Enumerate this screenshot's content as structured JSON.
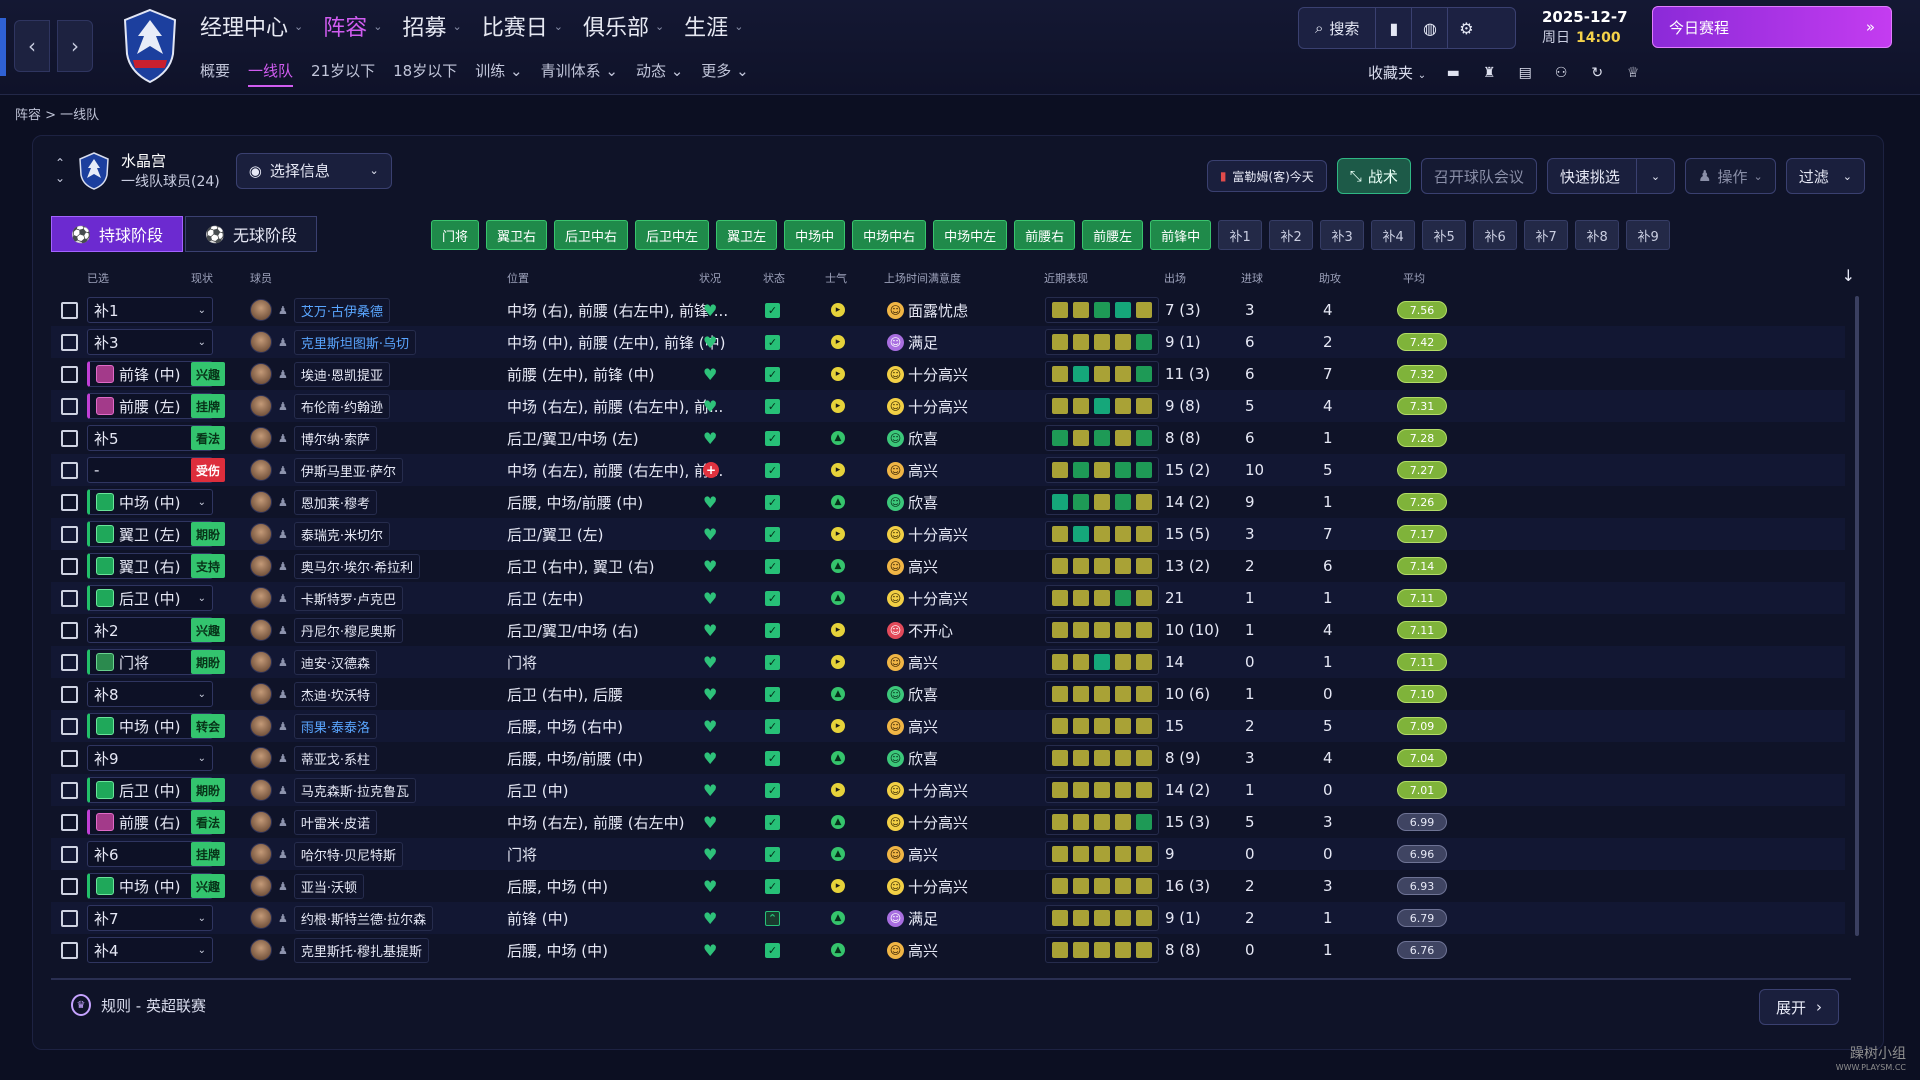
{
  "nav": {
    "main": [
      "经理中心",
      "阵容",
      "招募",
      "比赛日",
      "俱乐部",
      "生涯"
    ],
    "active_main": 1,
    "sub": [
      "概要",
      "一线队",
      "21岁以下",
      "18岁以下",
      "训练",
      "青训体系",
      "动态",
      "更多"
    ],
    "active_sub": 1
  },
  "toolbar": {
    "search_label": "搜索",
    "date": "2025-12-7",
    "weekday": "周日",
    "time": "14:00",
    "continue_label": "今日赛程",
    "favorites_label": "收藏夹"
  },
  "breadcrumb": "阵容 > 一线队",
  "team": {
    "name": "水晶宫",
    "subtitle": "一线队球员(24)"
  },
  "header": {
    "select_info_label": "选择信息",
    "next_match": "富勒姆(客)今天",
    "tactics_label": "战术",
    "team_meeting_label": "召开球队会议",
    "quick_pick_label": "快速挑选",
    "actions_label": "操作",
    "filter_label": "过滤"
  },
  "phase_tabs": [
    "持球阶段",
    "无球阶段"
  ],
  "position_chips": [
    "门将",
    "翼卫右",
    "后卫中右",
    "后卫中左",
    "翼卫左",
    "中场中",
    "中场中右",
    "中场中左",
    "前腰右",
    "前腰左",
    "前锋中"
  ],
  "sub_chips": [
    "补1",
    "补2",
    "补3",
    "补4",
    "补5",
    "补6",
    "补7",
    "补8",
    "补9"
  ],
  "columns": {
    "selected": "已选",
    "status_now": "现状",
    "player": "球员",
    "position": "位置",
    "fitness": "状况",
    "condition": "状态",
    "morale": "士气",
    "playing_time": "上场时间满意度",
    "form": "近期表现",
    "apps": "出场",
    "goals": "进球",
    "assists": "助攻",
    "avg": "平均"
  },
  "players": [
    {
      "sel": "补1",
      "sel_type": "none",
      "tag": "",
      "tag_color": "",
      "name": "艾万·古伊桑德",
      "link": true,
      "pos": "中场 (右), 前腰 (右左中), 前锋 ...",
      "inj": false,
      "rest": false,
      "morale": "yellow",
      "mood": "面露忧虑",
      "mood_color": "orange",
      "form": [
        "gold",
        "gold",
        "green",
        "teal",
        "gold"
      ],
      "apps": "7 (3)",
      "goals": "3",
      "assists": "4",
      "avg": "7.56",
      "avg_class": "good"
    },
    {
      "sel": "补3",
      "sel_type": "none",
      "tag": "",
      "tag_color": "",
      "name": "克里斯坦图斯·乌切",
      "link": true,
      "pos": "中场 (中), 前腰 (左中), 前锋 (中)",
      "inj": false,
      "rest": false,
      "morale": "yellow",
      "mood": "满足",
      "mood_color": "purple",
      "form": [
        "gold",
        "gold",
        "gold",
        "gold",
        "green"
      ],
      "apps": "9 (1)",
      "goals": "6",
      "assists": "2",
      "avg": "7.42",
      "avg_class": "good"
    },
    {
      "sel": "前锋 (中)",
      "sel_type": "purple",
      "tag": "兴趣",
      "tag_color": "green",
      "name": "埃迪·恩凯提亚",
      "link": false,
      "pos": "前腰 (左中), 前锋 (中)",
      "inj": false,
      "rest": false,
      "morale": "yellow",
      "mood": "十分高兴",
      "mood_color": "yellow",
      "form": [
        "gold",
        "teal",
        "gold",
        "gold",
        "green"
      ],
      "apps": "11 (3)",
      "goals": "6",
      "assists": "7",
      "avg": "7.32",
      "avg_class": "good"
    },
    {
      "sel": "前腰 (左)",
      "sel_type": "purple",
      "tag": "挂牌",
      "tag_color": "green",
      "name": "布伦南·约翰逊",
      "link": false,
      "pos": "中场 (右左), 前腰 (右左中), 前...",
      "inj": false,
      "rest": false,
      "morale": "yellow",
      "mood": "十分高兴",
      "mood_color": "yellow",
      "form": [
        "gold",
        "gold",
        "teal",
        "gold",
        "gold"
      ],
      "apps": "9 (8)",
      "goals": "5",
      "assists": "4",
      "avg": "7.31",
      "avg_class": "good"
    },
    {
      "sel": "补5",
      "sel_type": "none",
      "tag": "看法",
      "tag_color": "green",
      "name": "博尔纳·索萨",
      "link": false,
      "pos": "后卫/翼卫/中场 (左)",
      "inj": false,
      "rest": false,
      "morale": "green",
      "mood": "欣喜",
      "mood_color": "green",
      "form": [
        "green",
        "gold",
        "green",
        "gold",
        "green"
      ],
      "apps": "8 (8)",
      "goals": "6",
      "assists": "1",
      "avg": "7.28",
      "avg_class": "good"
    },
    {
      "sel": "-",
      "sel_type": "none",
      "tag": "受伤",
      "tag_color": "red",
      "name": "伊斯马里亚·萨尔",
      "link": false,
      "pos": "中场 (右左), 前腰 (右左中), 前...",
      "inj": true,
      "rest": false,
      "morale": "yellow",
      "mood": "高兴",
      "mood_color": "orange",
      "form": [
        "gold",
        "green",
        "gold",
        "green",
        "green"
      ],
      "apps": "15 (2)",
      "goals": "10",
      "assists": "5",
      "avg": "7.27",
      "avg_class": "good"
    },
    {
      "sel": "中场 (中)",
      "sel_type": "green",
      "tag": "",
      "tag_color": "",
      "name": "恩加莱·穆考",
      "link": false,
      "pos": "后腰, 中场/前腰 (中)",
      "inj": false,
      "rest": false,
      "morale": "green",
      "mood": "欣喜",
      "mood_color": "green",
      "form": [
        "teal",
        "green",
        "gold",
        "green",
        "gold"
      ],
      "apps": "14 (2)",
      "goals": "9",
      "assists": "1",
      "avg": "7.26",
      "avg_class": "good"
    },
    {
      "sel": "翼卫 (左)",
      "sel_type": "green",
      "tag": "期盼",
      "tag_color": "green",
      "name": "泰瑞克·米切尔",
      "link": false,
      "pos": "后卫/翼卫 (左)",
      "inj": false,
      "rest": false,
      "morale": "yellow",
      "mood": "十分高兴",
      "mood_color": "yellow",
      "form": [
        "gold",
        "teal",
        "gold",
        "gold",
        "gold"
      ],
      "apps": "15 (5)",
      "goals": "3",
      "assists": "7",
      "avg": "7.17",
      "avg_class": "good"
    },
    {
      "sel": "翼卫 (右)",
      "sel_type": "green",
      "tag": "支持",
      "tag_color": "green",
      "name": "奥马尔·埃尔·希拉利",
      "link": false,
      "pos": "后卫 (右中), 翼卫 (右)",
      "inj": false,
      "rest": false,
      "morale": "green",
      "mood": "高兴",
      "mood_color": "orange",
      "form": [
        "gold",
        "gold",
        "gold",
        "gold",
        "gold"
      ],
      "apps": "13 (2)",
      "goals": "2",
      "assists": "6",
      "avg": "7.14",
      "avg_class": "good"
    },
    {
      "sel": "后卫 (中)",
      "sel_type": "green",
      "tag": "",
      "tag_color": "",
      "name": "卡斯特罗·卢克巴",
      "link": false,
      "pos": "后卫 (左中)",
      "inj": false,
      "rest": false,
      "morale": "green",
      "mood": "十分高兴",
      "mood_color": "yellow",
      "form": [
        "gold",
        "gold",
        "gold",
        "green",
        "gold"
      ],
      "apps": "21",
      "goals": "1",
      "assists": "1",
      "avg": "7.11",
      "avg_class": "good"
    },
    {
      "sel": "补2",
      "sel_type": "none",
      "tag": "兴趣",
      "tag_color": "green",
      "name": "丹尼尔·穆尼奥斯",
      "link": false,
      "pos": "后卫/翼卫/中场 (右)",
      "inj": false,
      "rest": false,
      "morale": "yellow",
      "mood": "不开心",
      "mood_color": "red",
      "form": [
        "gold",
        "gold",
        "gold",
        "gold",
        "gold"
      ],
      "apps": "10 (10)",
      "goals": "1",
      "assists": "4",
      "avg": "7.11",
      "avg_class": "good"
    },
    {
      "sel": "门将",
      "sel_type": "gk",
      "tag": "期盼",
      "tag_color": "green",
      "name": "迪安·汉德森",
      "link": false,
      "pos": "门将",
      "inj": false,
      "rest": false,
      "morale": "yellow",
      "mood": "高兴",
      "mood_color": "orange",
      "form": [
        "gold",
        "gold",
        "teal",
        "gold",
        "gold"
      ],
      "apps": "14",
      "goals": "0",
      "assists": "1",
      "avg": "7.11",
      "avg_class": "good"
    },
    {
      "sel": "补8",
      "sel_type": "none",
      "tag": "",
      "tag_color": "",
      "name": "杰迪·坎沃特",
      "link": false,
      "pos": "后卫 (右中), 后腰",
      "inj": false,
      "rest": false,
      "morale": "green",
      "mood": "欣喜",
      "mood_color": "green",
      "form": [
        "gold",
        "gold",
        "gold",
        "gold",
        "gold"
      ],
      "apps": "10 (6)",
      "goals": "1",
      "assists": "0",
      "avg": "7.10",
      "avg_class": "good"
    },
    {
      "sel": "中场 (中)",
      "sel_type": "green",
      "tag": "转会",
      "tag_color": "green",
      "name": "雨果·泰泰洛",
      "link": true,
      "pos": "后腰, 中场 (右中)",
      "inj": false,
      "rest": false,
      "morale": "yellow",
      "mood": "高兴",
      "mood_color": "orange",
      "form": [
        "gold",
        "gold",
        "gold",
        "gold",
        "gold"
      ],
      "apps": "15",
      "goals": "2",
      "assists": "5",
      "avg": "7.09",
      "avg_class": "good"
    },
    {
      "sel": "补9",
      "sel_type": "none",
      "tag": "",
      "tag_color": "",
      "name": "蒂亚戈·系柱",
      "link": false,
      "pos": "后腰, 中场/前腰 (中)",
      "inj": false,
      "rest": false,
      "morale": "green",
      "mood": "欣喜",
      "mood_color": "green",
      "form": [
        "gold",
        "gold",
        "gold",
        "gold",
        "gold"
      ],
      "apps": "8 (9)",
      "goals": "3",
      "assists": "4",
      "avg": "7.04",
      "avg_class": "good"
    },
    {
      "sel": "后卫 (中)",
      "sel_type": "green",
      "tag": "期盼",
      "tag_color": "green",
      "name": "马克森斯·拉克鲁瓦",
      "link": false,
      "pos": "后卫 (中)",
      "inj": false,
      "rest": false,
      "morale": "yellow",
      "mood": "十分高兴",
      "mood_color": "yellow",
      "form": [
        "gold",
        "gold",
        "gold",
        "gold",
        "gold"
      ],
      "apps": "14 (2)",
      "goals": "1",
      "assists": "0",
      "avg": "7.01",
      "avg_class": "good"
    },
    {
      "sel": "前腰 (右)",
      "sel_type": "purple",
      "tag": "看法",
      "tag_color": "green",
      "name": "叶雷米·皮诺",
      "link": false,
      "pos": "中场 (右左), 前腰 (右左中)",
      "inj": false,
      "rest": false,
      "morale": "green",
      "mood": "十分高兴",
      "mood_color": "yellow",
      "form": [
        "gold",
        "gold",
        "gold",
        "gold",
        "green"
      ],
      "apps": "15 (3)",
      "goals": "5",
      "assists": "3",
      "avg": "6.99",
      "avg_class": "ok"
    },
    {
      "sel": "补6",
      "sel_type": "none",
      "tag": "挂牌",
      "tag_color": "green",
      "name": "哈尔特·贝尼特斯",
      "link": false,
      "pos": "门将",
      "inj": false,
      "rest": false,
      "morale": "green",
      "mood": "高兴",
      "mood_color": "orange",
      "form": [
        "gold",
        "gold",
        "gold",
        "gold",
        "gold"
      ],
      "apps": "9",
      "goals": "0",
      "assists": "0",
      "avg": "6.96",
      "avg_class": "ok"
    },
    {
      "sel": "中场 (中)",
      "sel_type": "green",
      "tag": "兴趣",
      "tag_color": "green",
      "name": "亚当·沃顿",
      "link": false,
      "pos": "后腰, 中场 (中)",
      "inj": false,
      "rest": false,
      "morale": "yellow",
      "mood": "十分高兴",
      "mood_color": "yellow",
      "form": [
        "gold",
        "gold",
        "gold",
        "gold",
        "gold"
      ],
      "apps": "16 (3)",
      "goals": "2",
      "assists": "3",
      "avg": "6.93",
      "avg_class": "ok"
    },
    {
      "sel": "补7",
      "sel_type": "none",
      "tag": "",
      "tag_color": "",
      "name": "约根·斯特兰德·拉尔森",
      "link": false,
      "pos": "前锋 (中)",
      "inj": false,
      "rest": true,
      "morale": "green",
      "mood": "满足",
      "mood_color": "purple",
      "form": [
        "gold",
        "gold",
        "gold",
        "gold",
        "gold"
      ],
      "apps": "9 (1)",
      "goals": "2",
      "assists": "1",
      "avg": "6.79",
      "avg_class": "ok"
    },
    {
      "sel": "补4",
      "sel_type": "none",
      "tag": "",
      "tag_color": "",
      "name": "克里斯托·穆扎基提斯",
      "link": false,
      "pos": "后腰, 中场 (中)",
      "inj": false,
      "rest": false,
      "morale": "green",
      "mood": "高兴",
      "mood_color": "orange",
      "form": [
        "gold",
        "gold",
        "gold",
        "gold",
        "gold"
      ],
      "apps": "8 (8)",
      "goals": "0",
      "assists": "1",
      "avg": "6.76",
      "avg_class": "ok"
    }
  ],
  "footer": {
    "rules_label": "规则 - 英超联赛",
    "expand_label": "展开"
  },
  "watermark": {
    "line1": "躁树小组",
    "line2": "WWW.PLAYSM.CC"
  },
  "colors": {
    "accent_purple": "#d05cf0",
    "positive_green": "#2ec27a",
    "bg": "#0c0f22"
  }
}
